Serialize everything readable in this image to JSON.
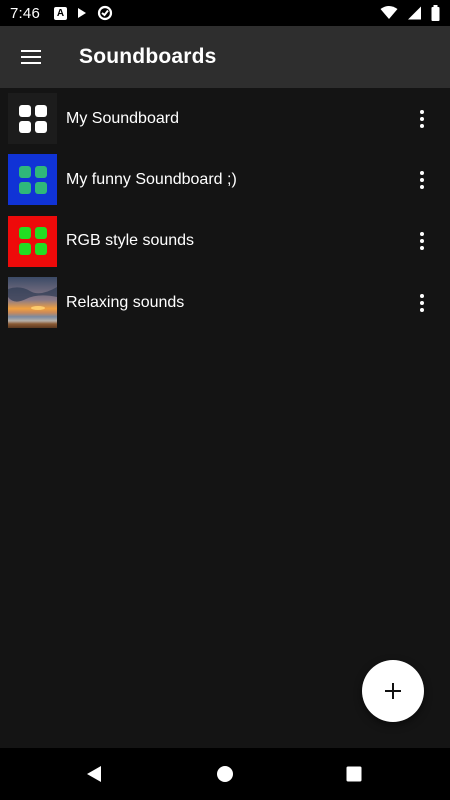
{
  "status_bar": {
    "time": "7:46",
    "notification_a": "A",
    "icons": [
      "a-notification-icon",
      "play-icon",
      "data-saver-icon",
      "wifi-icon",
      "signal-icon",
      "battery-icon"
    ]
  },
  "app_bar": {
    "title": "Soundboards",
    "menu_icon": "hamburger-menu-icon"
  },
  "soundboards": [
    {
      "label": "My Soundboard",
      "thumbnail": "grid-icon",
      "bg": "#1c1c1c",
      "tile": "#ffffff"
    },
    {
      "label": "My funny Soundboard ;)",
      "thumbnail": "grid-icon",
      "bg": "#1033d6",
      "tile": "#2fb87a"
    },
    {
      "label": "RGB style sounds",
      "thumbnail": "grid-icon",
      "bg": "#ee0a0a",
      "tile": "#22dd22"
    },
    {
      "label": "Relaxing sounds",
      "thumbnail": "sunset-beach-image",
      "bg": "#6b6b7a",
      "tile": ""
    }
  ],
  "fab": {
    "icon": "plus-icon"
  },
  "nav_bar": {
    "icons": [
      "back-icon",
      "home-icon",
      "recents-icon"
    ]
  },
  "colors": {
    "background": "#141414",
    "app_bar": "#2e2e2e",
    "status_bar": "#000000"
  }
}
